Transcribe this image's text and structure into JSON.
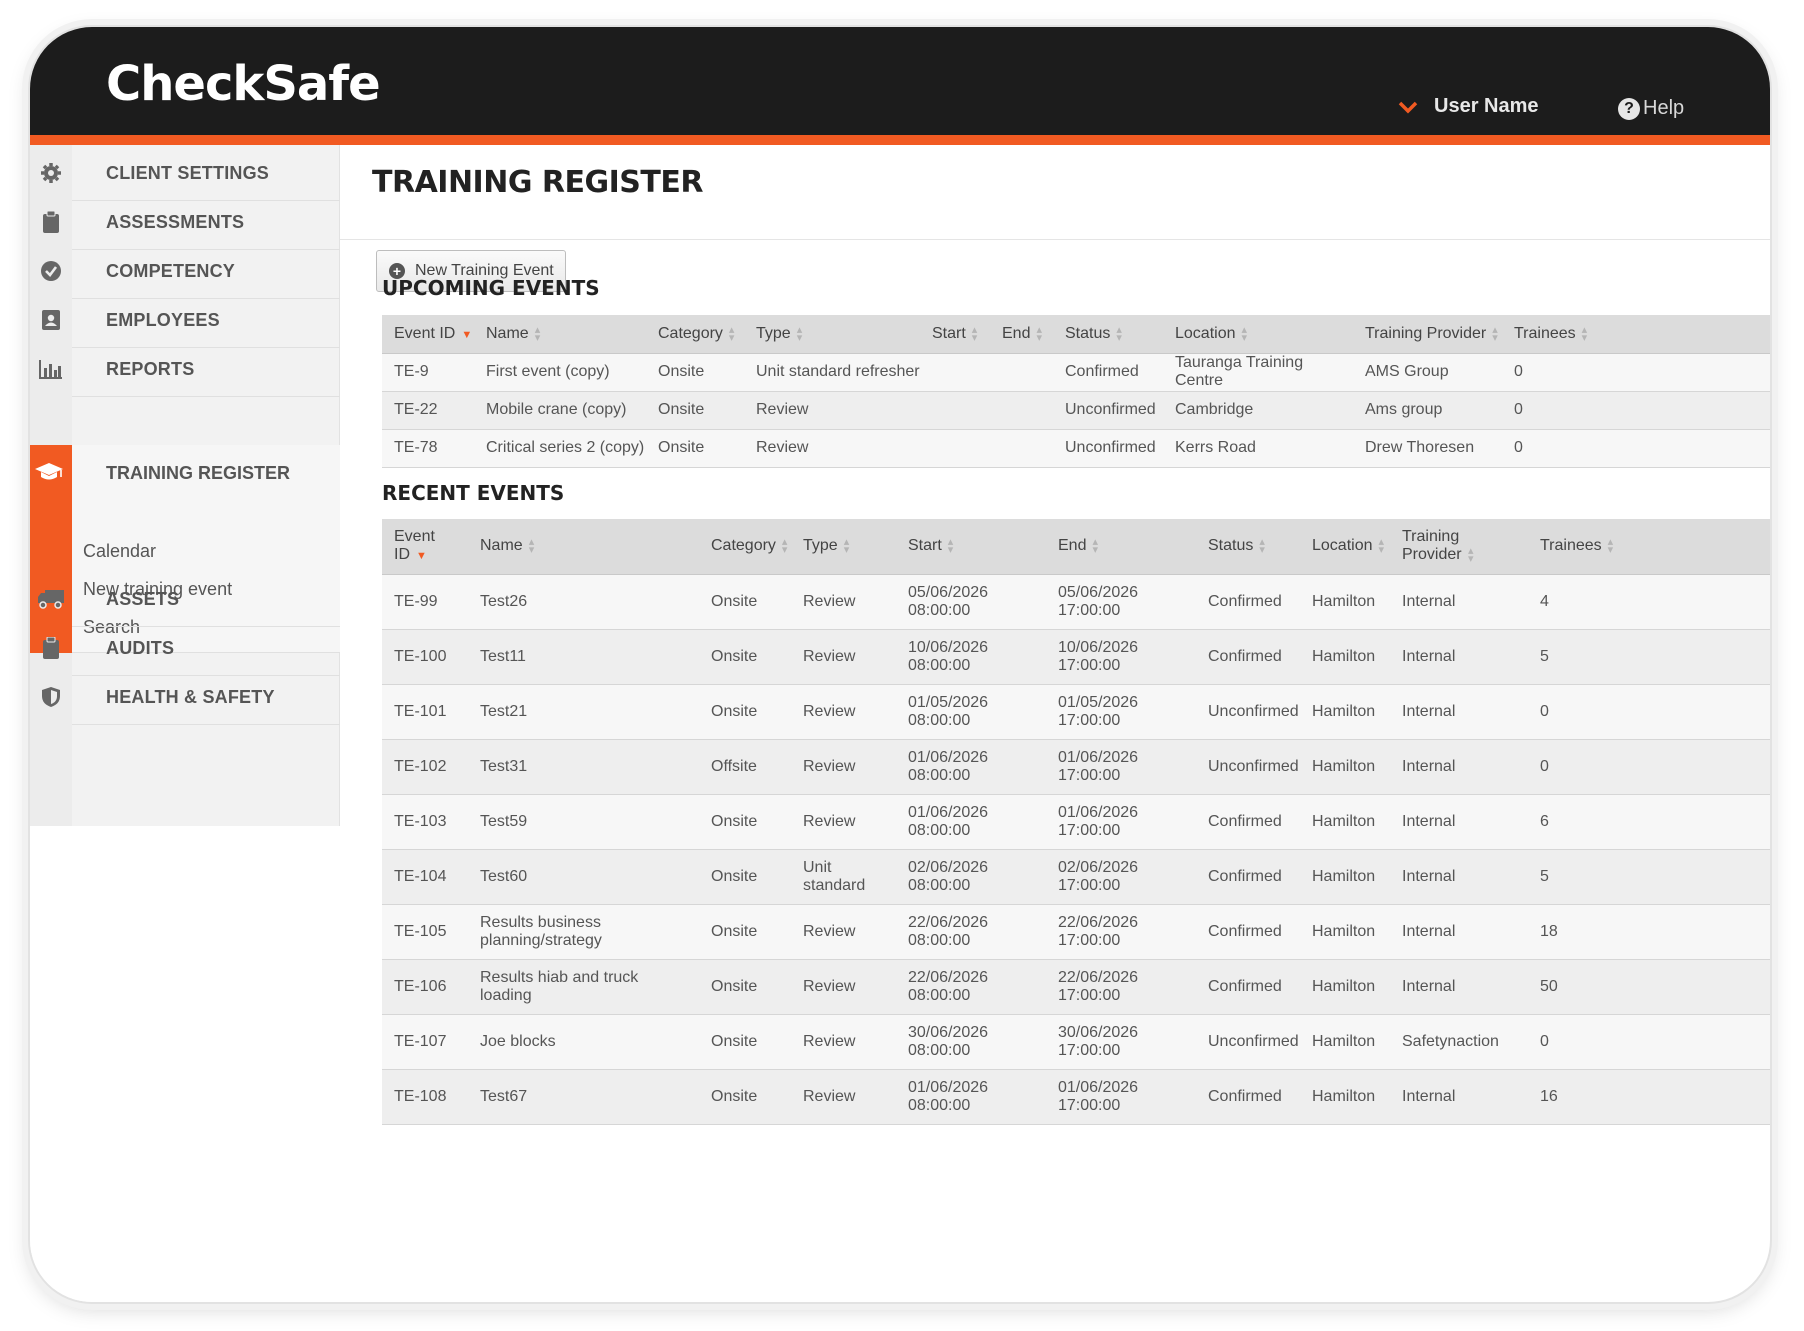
{
  "app": {
    "logo_text": "CheckSafe",
    "user_name": "User Name",
    "help_label": "Help"
  },
  "colors": {
    "accent": "#f15a22",
    "header_bg": "#1c1c1c"
  },
  "sidebar": {
    "items": [
      {
        "label": "CLIENT SETTINGS",
        "icon": "gear-icon"
      },
      {
        "label": "ASSESSMENTS",
        "icon": "clipboard-icon"
      },
      {
        "label": "COMPETENCY",
        "icon": "check-circle-icon"
      },
      {
        "label": "EMPLOYEES",
        "icon": "contact-book-icon"
      },
      {
        "label": "REPORTS",
        "icon": "bar-chart-icon"
      },
      {
        "label": "TRAINING REGISTER",
        "icon": "graduation-cap-icon"
      },
      {
        "label": "ASSETS",
        "icon": "truck-icon"
      },
      {
        "label": "AUDITS",
        "icon": "clipboard-icon"
      },
      {
        "label": "HEALTH & SAFETY",
        "icon": "shield-icon"
      }
    ],
    "sub_items": [
      "Calendar",
      "New training event",
      "Search"
    ]
  },
  "page": {
    "title": "TRAINING REGISTER",
    "new_button": "New Training Event",
    "upcoming_title": "UPCOMING EVENTS",
    "recent_title": "RECENT EVENTS"
  },
  "upcoming": {
    "columns": [
      "Event ID",
      "Name",
      "Category",
      "Type",
      "Start",
      "End",
      "Status",
      "Location",
      "Training Provider",
      "Trainees"
    ],
    "rows": [
      [
        "TE-9",
        "First event (copy)",
        "Onsite",
        "Unit standard refresher",
        "",
        "",
        "Confirmed",
        "Tauranga Training Centre",
        "AMS Group",
        "0"
      ],
      [
        "TE-22",
        "Mobile crane (copy)",
        "Onsite",
        "Review",
        "",
        "",
        "Unconfirmed",
        "Cambridge",
        "Ams group",
        "0"
      ],
      [
        "TE-78",
        "Critical series 2 (copy)",
        "Onsite",
        "Review",
        "",
        "",
        "Unconfirmed",
        "Kerrs Road",
        "Drew Thoresen",
        "0"
      ]
    ]
  },
  "recent": {
    "columns": [
      "Event ID",
      "Name",
      "Category",
      "Type",
      "Start",
      "End",
      "Status",
      "Location",
      "Training Provider",
      "Trainees"
    ],
    "rows": [
      [
        "TE-99",
        "Test26",
        "Onsite",
        "Review",
        "05/06/2026 08:00:00",
        "05/06/2026 17:00:00",
        "Confirmed",
        "Hamilton",
        "Internal",
        "4"
      ],
      [
        "TE-100",
        "Test11",
        "Onsite",
        "Review",
        "10/06/2026 08:00:00",
        "10/06/2026 17:00:00",
        "Confirmed",
        "Hamilton",
        "Internal",
        "5"
      ],
      [
        "TE-101",
        "Test21",
        "Onsite",
        "Review",
        "01/05/2026 08:00:00",
        "01/05/2026 17:00:00",
        "Unconfirmed",
        "Hamilton",
        "Internal",
        "0"
      ],
      [
        "TE-102",
        "Test31",
        "Offsite",
        "Review",
        "01/06/2026 08:00:00",
        "01/06/2026 17:00:00",
        "Unconfirmed",
        "Hamilton",
        "Internal",
        "0"
      ],
      [
        "TE-103",
        "Test59",
        "Onsite",
        "Review",
        "01/06/2026 08:00:00",
        "01/06/2026 17:00:00",
        "Confirmed",
        "Hamilton",
        "Internal",
        "6"
      ],
      [
        "TE-104",
        "Test60",
        "Onsite",
        "Unit standard",
        "02/06/2026 08:00:00",
        "02/06/2026 17:00:00",
        "Confirmed",
        "Hamilton",
        "Internal",
        "5"
      ],
      [
        "TE-105",
        "Results business planning/strategy",
        "Onsite",
        "Review",
        "22/06/2026 08:00:00",
        "22/06/2026 17:00:00",
        "Confirmed",
        "Hamilton",
        "Internal",
        "18"
      ],
      [
        "TE-106",
        "Results hiab and truck loading",
        "Onsite",
        "Review",
        "22/06/2026 08:00:00",
        "22/06/2026 17:00:00",
        "Confirmed",
        "Hamilton",
        "Internal",
        "50"
      ],
      [
        "TE-107",
        "Joe blocks",
        "Onsite",
        "Review",
        "30/06/2026 08:00:00",
        "30/06/2026 17:00:00",
        "Unconfirmed",
        "Hamilton",
        "Safetynaction",
        "0"
      ],
      [
        "TE-108",
        "Test67",
        "Onsite",
        "Review",
        "01/06/2026 08:00:00",
        "01/06/2026 17:00:00",
        "Confirmed",
        "Hamilton",
        "Internal",
        "16"
      ]
    ]
  }
}
